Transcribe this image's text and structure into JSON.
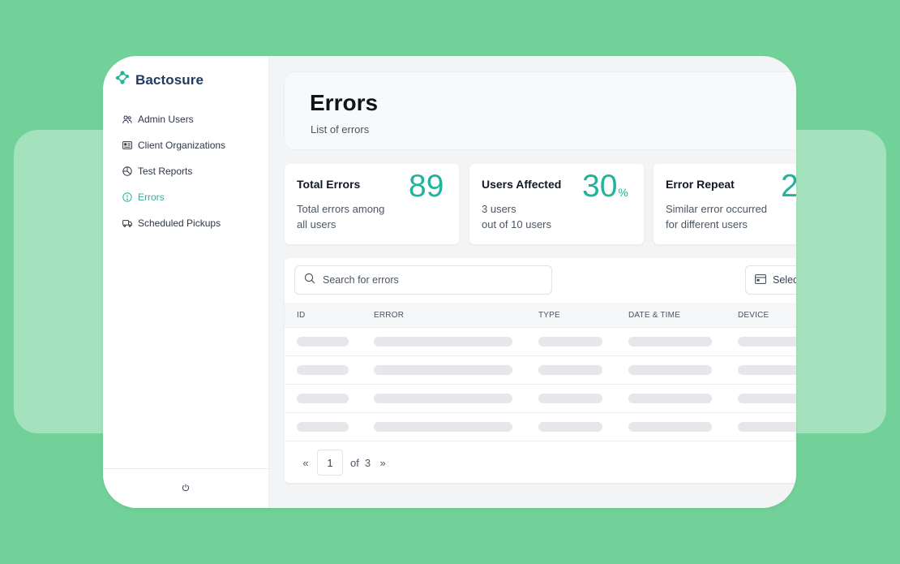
{
  "brand": {
    "name": "Bactosure",
    "accent": "#22b39b",
    "navy": "#1e3a5f"
  },
  "sidebar": {
    "items": [
      {
        "label": "Admin Users",
        "icon": "users-icon",
        "active": false
      },
      {
        "label": "Client Organizations",
        "icon": "id-card-icon",
        "active": false
      },
      {
        "label": "Test Reports",
        "icon": "pie-chart-icon",
        "active": false
      },
      {
        "label": "Errors",
        "icon": "alert-circle-icon",
        "active": true
      },
      {
        "label": "Scheduled Pickups",
        "icon": "truck-icon",
        "active": false
      }
    ],
    "footer_icon": "power-icon"
  },
  "header": {
    "title": "Errors",
    "subtitle": "List of errors"
  },
  "stats": [
    {
      "title": "Total Errors",
      "value": "89",
      "unit": "",
      "line1": "Total errors among",
      "line2": "all users"
    },
    {
      "title": "Users Affected",
      "value": "30",
      "unit": "%",
      "line1": "3 users",
      "line2": "out of 10 users"
    },
    {
      "title": "Error Repeat",
      "value": "2",
      "unit": "",
      "line1": "Similar error occurred",
      "line2": "for different users"
    }
  ],
  "table": {
    "search_placeholder": "Search for errors",
    "select_label": "Select",
    "columns": [
      "ID",
      "ERROR",
      "TYPE",
      "DATE & TIME",
      "DEVICE"
    ],
    "loading_rows": 4
  },
  "pagination": {
    "prev": "«",
    "current": "1",
    "of_label": "of",
    "total": "3",
    "next": "»"
  }
}
